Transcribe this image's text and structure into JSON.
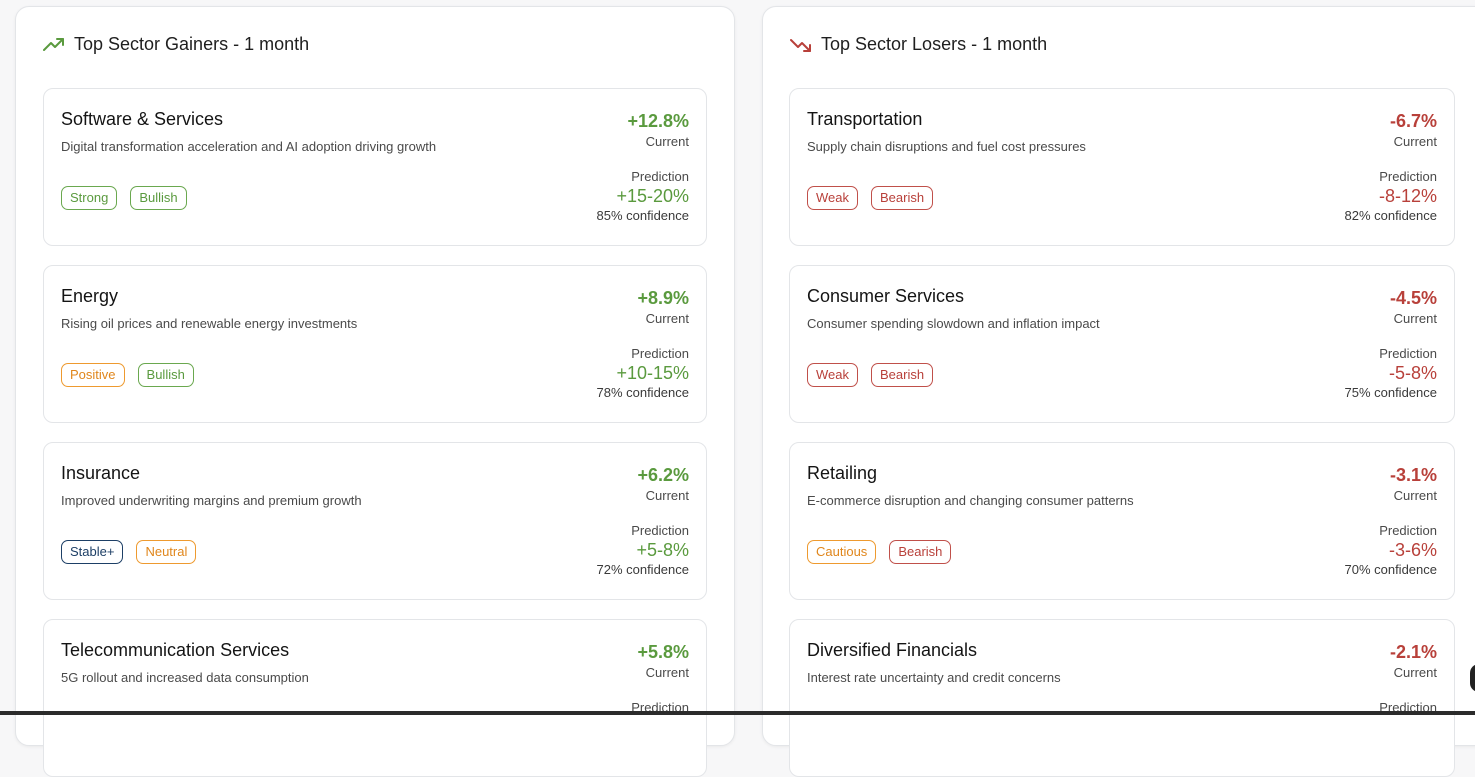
{
  "colors": {
    "gain": "#5a9a3e",
    "loss": "#b8403a",
    "tag_green": "#6aa84f",
    "tag_orange": "#ee9a2f",
    "tag_blue": "#1d3f66",
    "tag_red": "#c0504a"
  },
  "gainers": {
    "title": "Top Sector Gainers - 1 month",
    "icon": "trending-up-icon",
    "cards": [
      {
        "name": "Software & Services",
        "desc": "Digital transformation acceleration and AI adoption driving growth",
        "tags": [
          {
            "label": "Strong",
            "tone": "green"
          },
          {
            "label": "Bullish",
            "tone": "green"
          }
        ],
        "current": "+12.8%",
        "current_label": "Current",
        "prediction_label": "Prediction",
        "prediction": "+15-20%",
        "confidence": "85% confidence"
      },
      {
        "name": "Energy",
        "desc": "Rising oil prices and renewable energy investments",
        "tags": [
          {
            "label": "Positive",
            "tone": "orange"
          },
          {
            "label": "Bullish",
            "tone": "green"
          }
        ],
        "current": "+8.9%",
        "current_label": "Current",
        "prediction_label": "Prediction",
        "prediction": "+10-15%",
        "confidence": "78% confidence"
      },
      {
        "name": "Insurance",
        "desc": "Improved underwriting margins and premium growth",
        "tags": [
          {
            "label": "Stable+",
            "tone": "blue"
          },
          {
            "label": "Neutral",
            "tone": "orange"
          }
        ],
        "current": "+6.2%",
        "current_label": "Current",
        "prediction_label": "Prediction",
        "prediction": "+5-8%",
        "confidence": "72% confidence"
      },
      {
        "name": "Telecommunication Services",
        "desc": "5G rollout and increased data consumption",
        "tags": [],
        "current": "+5.8%",
        "current_label": "Current",
        "prediction_label": "Prediction",
        "prediction": "",
        "confidence": ""
      }
    ]
  },
  "losers": {
    "title": "Top Sector Losers - 1 month",
    "icon": "trending-down-icon",
    "cards": [
      {
        "name": "Transportation",
        "desc": "Supply chain disruptions and fuel cost pressures",
        "tags": [
          {
            "label": "Weak",
            "tone": "red"
          },
          {
            "label": "Bearish",
            "tone": "red"
          }
        ],
        "current": "-6.7%",
        "current_label": "Current",
        "prediction_label": "Prediction",
        "prediction": "-8-12%",
        "confidence": "82% confidence"
      },
      {
        "name": "Consumer Services",
        "desc": "Consumer spending slowdown and inflation impact",
        "tags": [
          {
            "label": "Weak",
            "tone": "red"
          },
          {
            "label": "Bearish",
            "tone": "red"
          }
        ],
        "current": "-4.5%",
        "current_label": "Current",
        "prediction_label": "Prediction",
        "prediction": "-5-8%",
        "confidence": "75% confidence"
      },
      {
        "name": "Retailing",
        "desc": "E-commerce disruption and changing consumer patterns",
        "tags": [
          {
            "label": "Cautious",
            "tone": "orange"
          },
          {
            "label": "Bearish",
            "tone": "red"
          }
        ],
        "current": "-3.1%",
        "current_label": "Current",
        "prediction_label": "Prediction",
        "prediction": "-3-6%",
        "confidence": "70% confidence"
      },
      {
        "name": "Diversified Financials",
        "desc": "Interest rate uncertainty and credit concerns",
        "tags": [],
        "current": "-2.1%",
        "current_label": "Current",
        "prediction_label": "Prediction",
        "prediction": "",
        "confidence": ""
      }
    ]
  }
}
